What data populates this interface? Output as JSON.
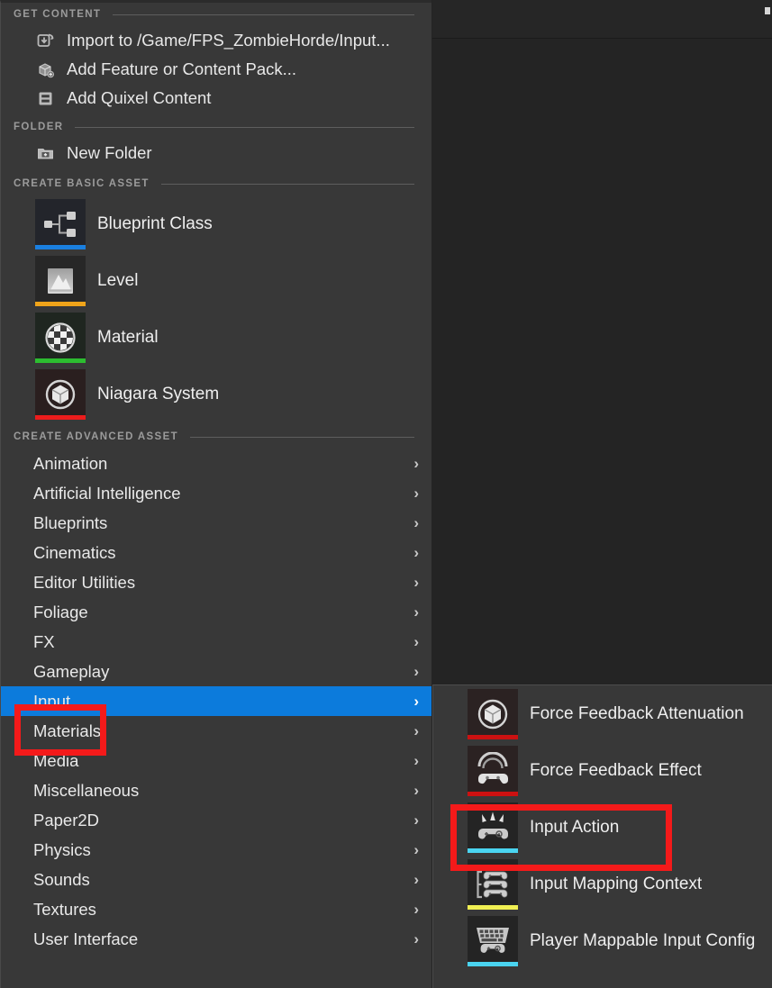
{
  "menu": {
    "sections": [
      {
        "key": "get_content",
        "title": "GET CONTENT"
      },
      {
        "key": "folder",
        "title": "FOLDER"
      },
      {
        "key": "basic",
        "title": "CREATE BASIC ASSET"
      },
      {
        "key": "advanced",
        "title": "CREATE ADVANCED ASSET"
      }
    ],
    "get_content_items": [
      {
        "label": "Import to /Game/FPS_ZombieHorde/Input...",
        "icon": "import-icon"
      },
      {
        "label": "Add Feature or Content Pack...",
        "icon": "content-pack-icon"
      },
      {
        "label": "Add Quixel Content",
        "icon": "quixel-icon"
      }
    ],
    "folder_items": [
      {
        "label": "New Folder",
        "icon": "new-folder-icon"
      }
    ],
    "basic_assets": [
      {
        "label": "Blueprint Class",
        "icon": "blueprint-class-icon",
        "bar_color": "#1a7fe0",
        "tile_color": "#23252b"
      },
      {
        "label": "Level",
        "icon": "level-icon",
        "bar_color": "#f0a41a",
        "tile_color": "#272727"
      },
      {
        "label": "Material",
        "icon": "material-icon",
        "bar_color": "#2cbd30",
        "tile_color": "#1f2620"
      },
      {
        "label": "Niagara System",
        "icon": "niagara-system-icon",
        "bar_color": "#ed1c1c",
        "tile_color": "#2a1f1f"
      }
    ],
    "advanced_assets": [
      {
        "label": "Animation",
        "selected": false
      },
      {
        "label": "Artificial Intelligence",
        "selected": false
      },
      {
        "label": "Blueprints",
        "selected": false
      },
      {
        "label": "Cinematics",
        "selected": false
      },
      {
        "label": "Editor Utilities",
        "selected": false
      },
      {
        "label": "Foliage",
        "selected": false
      },
      {
        "label": "FX",
        "selected": false
      },
      {
        "label": "Gameplay",
        "selected": false
      },
      {
        "label": "Input",
        "selected": true
      },
      {
        "label": "Materials",
        "selected": false
      },
      {
        "label": "Media",
        "selected": false
      },
      {
        "label": "Miscellaneous",
        "selected": false
      },
      {
        "label": "Paper2D",
        "selected": false
      },
      {
        "label": "Physics",
        "selected": false
      },
      {
        "label": "Sounds",
        "selected": false
      },
      {
        "label": "Textures",
        "selected": false
      },
      {
        "label": "User Interface",
        "selected": false
      }
    ],
    "submenu_arrow": "›"
  },
  "submenu": {
    "items": [
      {
        "label": "Force Feedback Attenuation",
        "icon": "force-feedback-attenuation-icon",
        "bar_color": "#cc1111",
        "tile_color": "#2b2222"
      },
      {
        "label": "Force Feedback Effect",
        "icon": "force-feedback-effect-icon",
        "bar_color": "#cc1111",
        "tile_color": "#2b2222"
      },
      {
        "label": "Input Action",
        "icon": "input-action-icon",
        "bar_color": "#4ad4f0",
        "tile_color": "#242424"
      },
      {
        "label": "Input Mapping Context",
        "icon": "input-mapping-context-icon",
        "bar_color": "#f0ef52",
        "tile_color": "#242424"
      },
      {
        "label": "Player Mappable Input Config",
        "icon": "player-mappable-input-config-icon",
        "bar_color": "#4ad4f0",
        "tile_color": "#242424"
      }
    ]
  },
  "annotations": [
    {
      "name": "input-highlight-box",
      "color": "#f41a1a",
      "target": "Input"
    },
    {
      "name": "input-action-highlight-box",
      "color": "#f41a1a",
      "target": "Input Action"
    }
  ],
  "colors": {
    "menu_background": "#383838",
    "selection_blue": "#0c7bdc",
    "annotation_red": "#f41a1a",
    "text_primary": "#e9e9e9",
    "text_section": "#9b9b9b"
  }
}
